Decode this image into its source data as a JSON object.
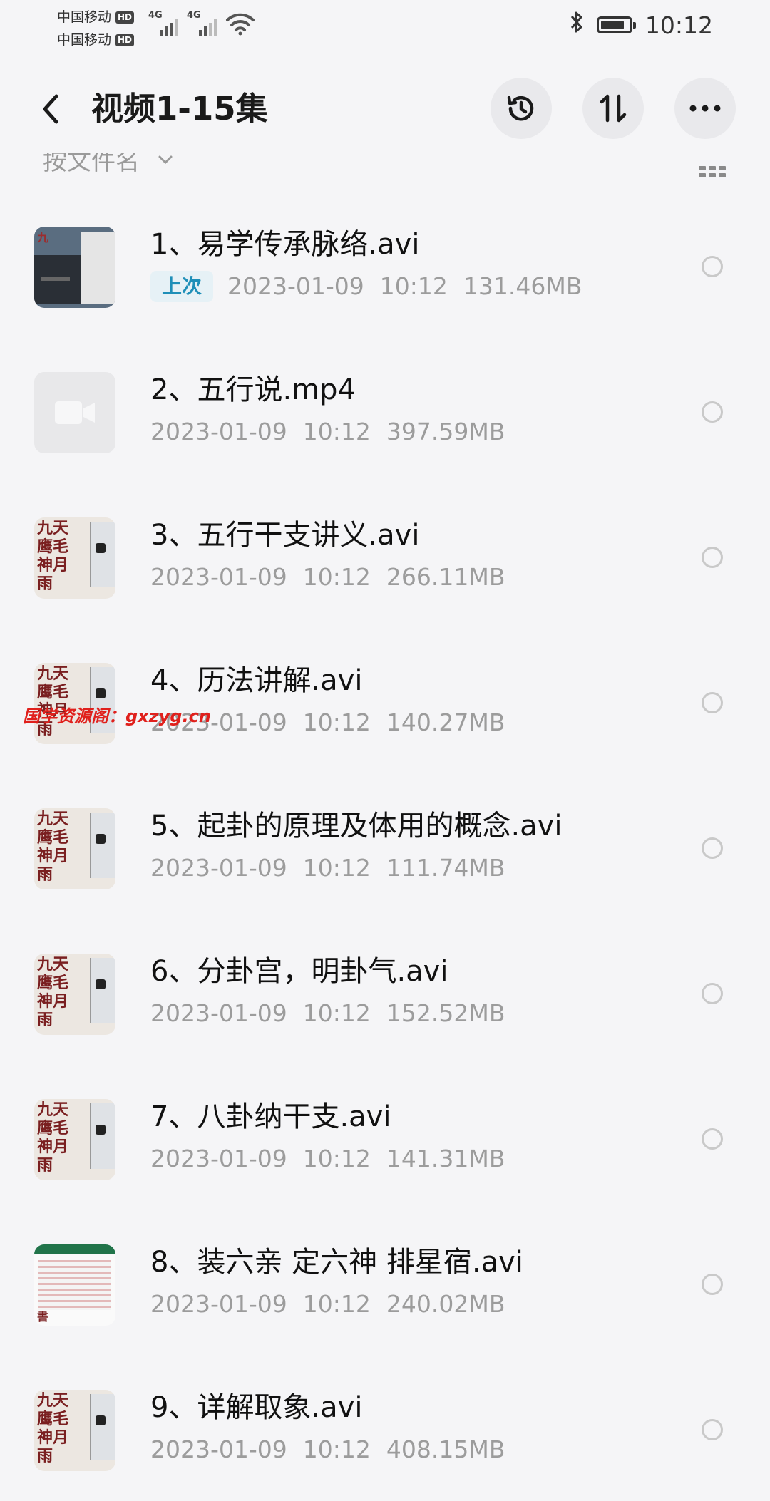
{
  "status_bar": {
    "carrier_1": "中国移动",
    "carrier_2": "中国移动",
    "hd_label": "HD",
    "network_1": "4G",
    "network_2": "4G",
    "time": "10:12",
    "icons": [
      "signal-icon",
      "wifi-icon",
      "bluetooth-icon",
      "battery-icon"
    ],
    "battery_level": 0.85
  },
  "header": {
    "title": "视频1-15集",
    "actions": [
      "back-icon",
      "history-icon",
      "sort-icon",
      "more-icon"
    ]
  },
  "sort_bar": {
    "label": "按文件名",
    "view_icon": "grid-view-icon"
  },
  "files": [
    {
      "name": "1、易学传承脉络.avi",
      "badge": "上次",
      "date": "2023-01-09",
      "time": "10:12",
      "size": "131.46MB",
      "thumb": "dark"
    },
    {
      "name": "2、五行说.mp4",
      "date": "2023-01-09",
      "time": "10:12",
      "size": "397.59MB",
      "thumb": "video"
    },
    {
      "name": "3、五行干支讲义.avi",
      "date": "2023-01-09",
      "time": "10:12",
      "size": "266.11MB",
      "thumb": "cal"
    },
    {
      "name": "4、历法讲解.avi",
      "date": "2023-01-09",
      "time": "10:12",
      "size": "140.27MB",
      "thumb": "cal"
    },
    {
      "name": "5、起卦的原理及体用的概念.avi",
      "date": "2023-01-09",
      "time": "10:12",
      "size": "111.74MB",
      "thumb": "cal"
    },
    {
      "name": "6、分卦宫，明卦气.avi",
      "date": "2023-01-09",
      "time": "10:12",
      "size": "152.52MB",
      "thumb": "cal"
    },
    {
      "name": "7、八卦纳干支.avi",
      "date": "2023-01-09",
      "time": "10:12",
      "size": "141.31MB",
      "thumb": "cal"
    },
    {
      "name": "8、装六亲 定六神 排星宿.avi",
      "date": "2023-01-09",
      "time": "10:12",
      "size": "240.02MB",
      "thumb": "sheet"
    },
    {
      "name": "9、详解取象.avi",
      "date": "2023-01-09",
      "time": "10:12",
      "size": "408.15MB",
      "thumb": "cal"
    }
  ],
  "thumbnail_text": {
    "cal": "九天\n鹰毛\n神月\n雨",
    "dark": "九",
    "sheet": "書"
  },
  "watermark": "国学资源阁：gxzyg.cn",
  "colors": {
    "background": "#f5f5f7",
    "badge_text": "#1f8fb8",
    "badge_bg": "#e6f1f6",
    "watermark": "#e0201c",
    "meta_text": "#9c9c9c"
  }
}
